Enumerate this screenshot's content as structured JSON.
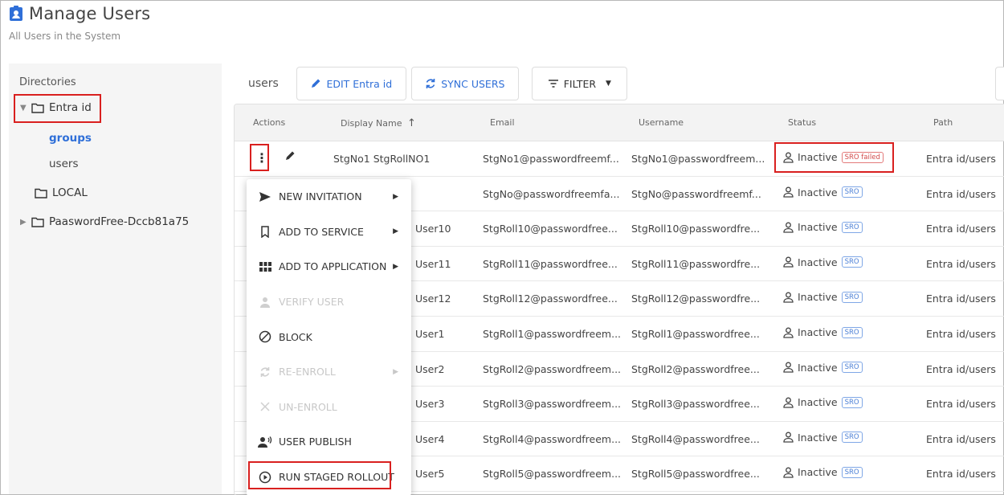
{
  "header": {
    "title": "Manage Users",
    "subtitle": "All Users in the System"
  },
  "sidebar": {
    "heading": "Directories",
    "tree": [
      {
        "label": "Entra id",
        "expanded": true,
        "children": [
          {
            "label": "groups",
            "active": true
          },
          {
            "label": "users",
            "active": false
          }
        ]
      },
      {
        "label": "LOCAL"
      },
      {
        "label": "PaaswordFree-Dccb81a75",
        "collapsed": true
      }
    ]
  },
  "toolbar": {
    "label": "users",
    "edit": "EDIT Entra id",
    "sync": "SYNC USERS",
    "filter": "FILTER"
  },
  "table": {
    "columns": [
      "Actions",
      "Display Name",
      "Email",
      "Username",
      "Status",
      "Path"
    ],
    "rows": [
      {
        "display": "StgNo1 StgRollNO1",
        "email": "StgNo1@passwordfreemf...",
        "username": "StgNo1@passwordfreem...",
        "status": "Inactive",
        "badge": "SRO failed",
        "path": "Entra id/users"
      },
      {
        "display": "",
        "email": "StgNo@passwordfreemfa...",
        "username": "StgNo@passwordfreemf...",
        "status": "Inactive",
        "badge": "SRO",
        "path": "Entra id/users"
      },
      {
        "display": "User10",
        "email": "StgRoll10@passwordfree...",
        "username": "StgRoll10@passwordfre...",
        "status": "Inactive",
        "badge": "SRO",
        "path": "Entra id/users"
      },
      {
        "display": "User11",
        "email": "StgRoll11@passwordfree...",
        "username": "StgRoll11@passwordfre...",
        "status": "Inactive",
        "badge": "SRO",
        "path": "Entra id/users"
      },
      {
        "display": "User12",
        "email": "StgRoll12@passwordfree...",
        "username": "StgRoll12@passwordfre...",
        "status": "Inactive",
        "badge": "SRO",
        "path": "Entra id/users"
      },
      {
        "display": "User1",
        "email": "StgRoll1@passwordfreem...",
        "username": "StgRoll1@passwordfree...",
        "status": "Inactive",
        "badge": "SRO",
        "path": "Entra id/users"
      },
      {
        "display": "User2",
        "email": "StgRoll2@passwordfreem...",
        "username": "StgRoll2@passwordfree...",
        "status": "Inactive",
        "badge": "SRO",
        "path": "Entra id/users"
      },
      {
        "display": "User3",
        "email": "StgRoll3@passwordfreem...",
        "username": "StgRoll3@passwordfree...",
        "status": "Inactive",
        "badge": "SRO",
        "path": "Entra id/users"
      },
      {
        "display": "User4",
        "email": "StgRoll4@passwordfreem...",
        "username": "StgRoll4@passwordfree...",
        "status": "Inactive",
        "badge": "SRO",
        "path": "Entra id/users"
      },
      {
        "display": "User5",
        "email": "StgRoll5@passwordfreem...",
        "username": "StgRoll5@passwordfree...",
        "status": "Inactive",
        "badge": "SRO",
        "path": "Entra id/users"
      }
    ]
  },
  "menu": {
    "items": [
      {
        "label": "NEW INVITATION",
        "icon": "send-icon",
        "submenu": true,
        "disabled": false
      },
      {
        "label": "ADD TO SERVICE",
        "icon": "bookmark-icon",
        "submenu": true,
        "disabled": false
      },
      {
        "label": "ADD TO APPLICATION",
        "icon": "apps-grid-icon",
        "submenu": true,
        "disabled": false
      },
      {
        "label": "VERIFY USER",
        "icon": "person-icon",
        "submenu": false,
        "disabled": true
      },
      {
        "label": "BLOCK",
        "icon": "block-icon",
        "submenu": false,
        "disabled": false
      },
      {
        "label": "RE-ENROLL",
        "icon": "sync-icon",
        "submenu": true,
        "disabled": true
      },
      {
        "label": "UN-ENROLL",
        "icon": "close-icon",
        "submenu": false,
        "disabled": true
      },
      {
        "label": "USER PUBLISH",
        "icon": "user-voice-icon",
        "submenu": false,
        "disabled": false
      },
      {
        "label": "RUN STAGED ROLLOUT",
        "icon": "play-circle-icon",
        "submenu": false,
        "disabled": false
      }
    ]
  },
  "colors": {
    "accent": "#2f6fd8",
    "highlight": "#d9201f",
    "badge_sro": "#4a7fd6",
    "badge_failed": "#d24a4a"
  }
}
